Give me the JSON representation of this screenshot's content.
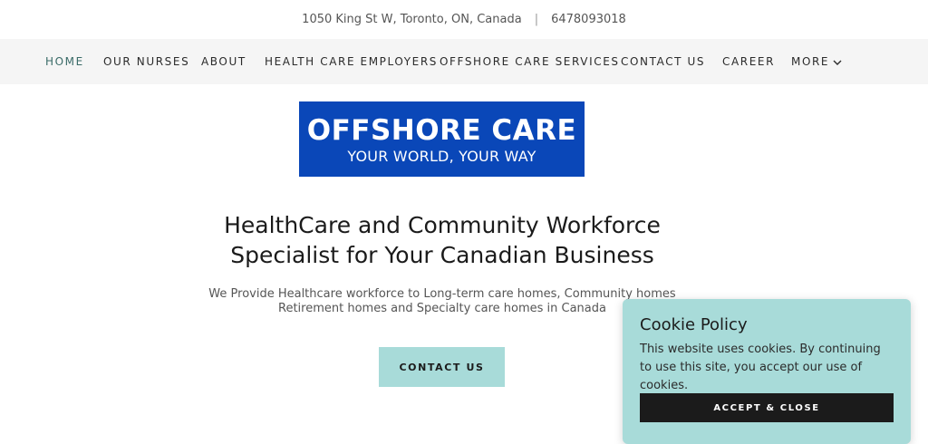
{
  "topbar": {
    "address": "1050 King St W, Toronto, ON, Canada",
    "separator": "|",
    "phone": "6478093018"
  },
  "nav": {
    "items": [
      {
        "label": "HOME",
        "active": true
      },
      {
        "label": "OUR NURSES"
      },
      {
        "label": "ABOUT"
      },
      {
        "label": "HEALTH CARE EMPLOYERS"
      },
      {
        "label": "OFFSHORE CARE SERVICES"
      },
      {
        "label": "CONTACT US"
      },
      {
        "label": "CAREER"
      },
      {
        "label": "MORE",
        "icon": "chevron-down-icon"
      }
    ]
  },
  "logo": {
    "line1": "OFFSHORE CARE",
    "line2": "YOUR WORLD, YOUR WAY",
    "background": "#0a47b8"
  },
  "hero": {
    "headline_line1": "HealthCare and Community Workforce",
    "headline_line2": "Specialist for Your Canadian Business",
    "sub_line1": "We Provide Healthcare workforce to Long-term care homes, Community homes",
    "sub_line2": "Retirement homes and Specialty care homes in Canada",
    "cta_label": "CONTACT US"
  },
  "cookie": {
    "title": "Cookie Policy",
    "text": "This website uses cookies. By continuing to use this site, you accept our use of cookies.",
    "button_label": "ACCEPT & CLOSE"
  },
  "colors": {
    "accent": "#a8dbd9",
    "nav_active": "#3a6b68",
    "nav_background": "#f5f5f5",
    "cookie_button": "#1b1b1b"
  }
}
